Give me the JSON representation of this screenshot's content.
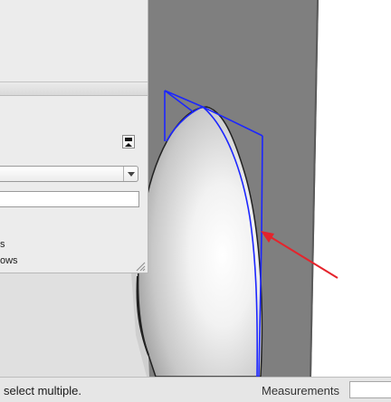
{
  "app": "SketchUp",
  "colors": {
    "canvas": "#ffffff",
    "wall_gray": "#7f7f7f",
    "panel_bg": "#ececec",
    "selection_blue": "#1c26ff",
    "arrow_red": "#e5242c",
    "statusbar_bg": "#e6e6e6"
  },
  "icons": {
    "toggle": "panel-collapse-icon",
    "dropdown": "chevron-down-icon",
    "grip": "resize-grip-icon"
  },
  "panel": {
    "option_1_fragment": "s",
    "option_2_fragment": "ows"
  },
  "statusbar": {
    "hint": "select multiple.",
    "measurements_label": "Measurements",
    "measurements_value": ""
  }
}
